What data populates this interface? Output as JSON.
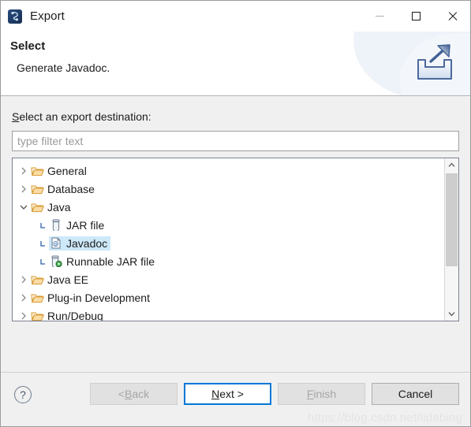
{
  "window": {
    "title": "Export",
    "icon": "eclipse-icon",
    "controls": {
      "minimize": "minimize-icon",
      "maximize": "maximize-icon",
      "close": "close-icon"
    }
  },
  "header": {
    "title": "Select",
    "subtitle": "Generate Javadoc.",
    "icon": "export-banner-icon"
  },
  "form": {
    "label_prefix": "S",
    "label_rest": "elect an export destination:",
    "filter": {
      "value": "",
      "placeholder": "type filter text"
    }
  },
  "tree": {
    "items": [
      {
        "label": "General",
        "icon": "folder-icon",
        "level": 0,
        "expander": "collapsed",
        "selected": false
      },
      {
        "label": "Database",
        "icon": "folder-icon",
        "level": 0,
        "expander": "collapsed",
        "selected": false
      },
      {
        "label": "Java",
        "icon": "folder-icon",
        "level": 0,
        "expander": "expanded",
        "selected": false
      },
      {
        "label": "JAR file",
        "icon": "jar-icon",
        "level": 1,
        "expander": "none",
        "selected": false
      },
      {
        "label": "Javadoc",
        "icon": "javadoc-icon",
        "level": 1,
        "expander": "none",
        "selected": true
      },
      {
        "label": "Runnable JAR file",
        "icon": "runnable-jar-icon",
        "level": 1,
        "expander": "none",
        "selected": false
      },
      {
        "label": "Java EE",
        "icon": "folder-icon",
        "level": 0,
        "expander": "collapsed",
        "selected": false
      },
      {
        "label": "Plug-in Development",
        "icon": "folder-icon",
        "level": 0,
        "expander": "collapsed",
        "selected": false
      },
      {
        "label": "Run/Debug",
        "icon": "folder-icon",
        "level": 0,
        "expander": "collapsed",
        "selected": false
      }
    ],
    "scrollbar": {
      "up_arrow": "chevron-up-icon",
      "down_arrow": "chevron-down-icon"
    }
  },
  "footer": {
    "help_label": "?",
    "buttons": [
      {
        "name": "back",
        "prefix": "< ",
        "mnemonic": "B",
        "rest": "ack",
        "state": "disabled"
      },
      {
        "name": "next",
        "prefix": "",
        "mnemonic": "N",
        "rest": "ext >",
        "state": "focused"
      },
      {
        "name": "finish",
        "prefix": "",
        "mnemonic": "F",
        "rest": "inish",
        "state": "disabled"
      },
      {
        "name": "cancel",
        "prefix": "",
        "mnemonic": "",
        "rest": "Cancel",
        "state": "enabled"
      }
    ]
  },
  "watermark": "https://blog.csdn.net/lidabing",
  "colors": {
    "accent": "#0078d7",
    "selection": "#cde8f9",
    "folder": "#e8a33d",
    "dialog_bg": "#f0f0f0"
  }
}
